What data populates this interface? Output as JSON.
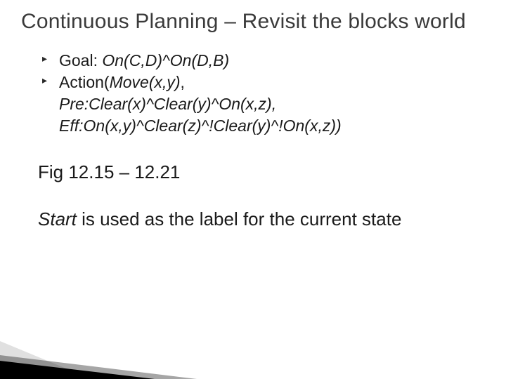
{
  "title": "Continuous Planning – Revisit the blocks world",
  "bullets": [
    {
      "prefix": "Goal: ",
      "ital": "On(C,D)^On(D,B)"
    },
    {
      "prefix": "Action(",
      "ital": "Move(x,y)",
      "suffix": ","
    }
  ],
  "cont_lines": [
    "Pre:Clear(x)^Clear(y)^On(x,z),",
    "Eff:On(x,y)^Clear(z)^!Clear(y)^!On(x,z))"
  ],
  "fig_line": "Fig 12.15 – 12.21",
  "start_para_ital": "Start",
  "start_para_rest": " is used as the label for the current state"
}
